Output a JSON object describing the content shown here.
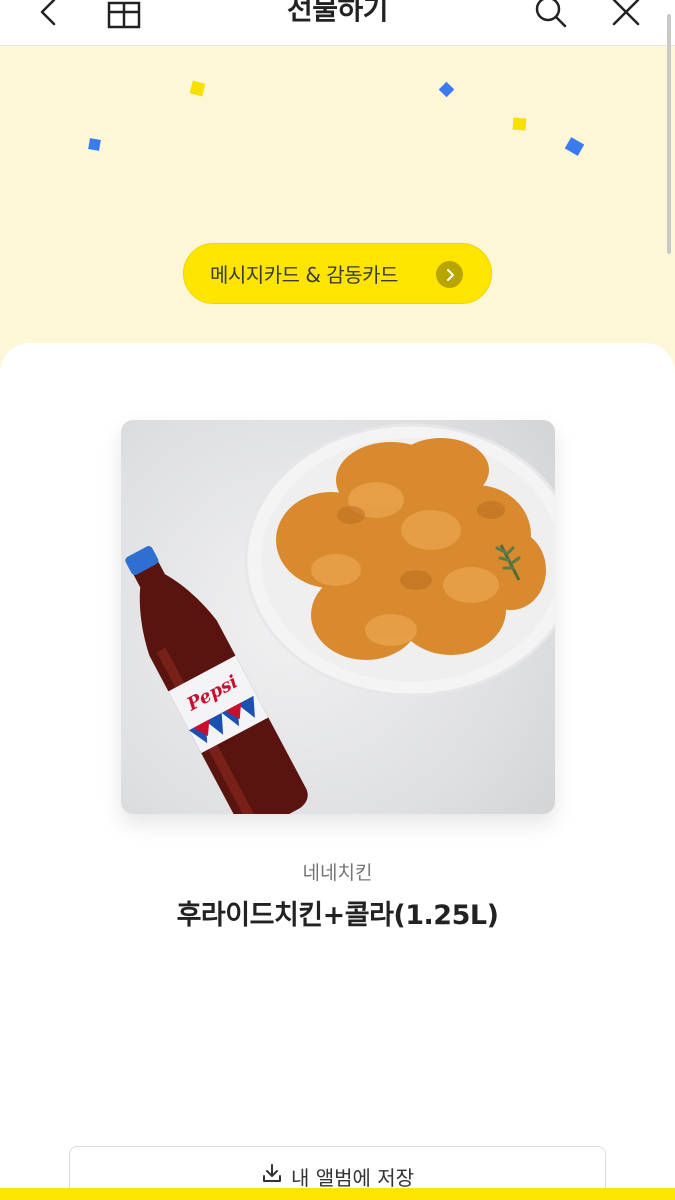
{
  "header": {
    "title": "선물하기",
    "icons": [
      "back-arrow-icon",
      "gift-icon",
      "search-icon",
      "close-icon"
    ]
  },
  "hero": {
    "background_color": "#fdf7d8",
    "message_card_label": "메시지카드 & 감동카드",
    "button_color": "#fee500"
  },
  "product": {
    "brand": "네네치킨",
    "name": "후라이드치킨+콜라(1.25L)",
    "image_content": "fried-chicken-and-pepsi-image"
  },
  "actions": {
    "save_label": "내 앨범에 저장"
  },
  "colors": {
    "accent_yellow": "#fee500",
    "confetti_blue": "#3b7bf0",
    "confetti_yellow": "#f6e000"
  }
}
